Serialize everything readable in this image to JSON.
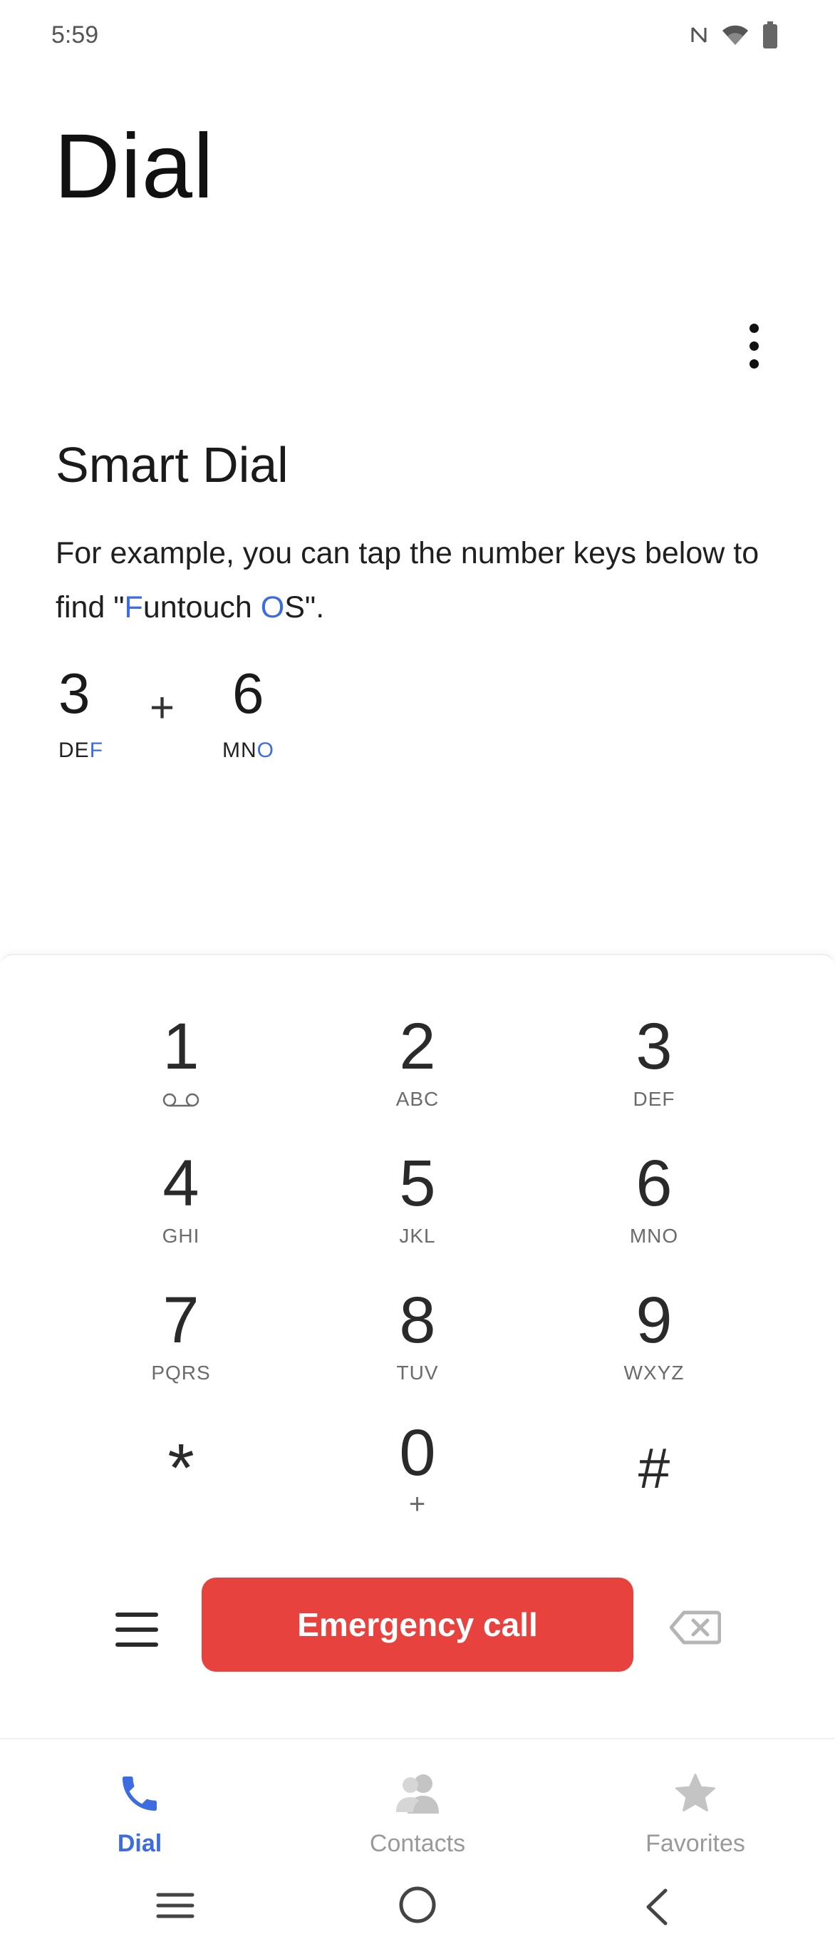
{
  "status_bar": {
    "time": "5:59",
    "icons": [
      "nfc-icon",
      "wifi-icon",
      "battery-icon"
    ]
  },
  "header": {
    "title": "Dial",
    "more_icon": "more-vert-icon"
  },
  "smart_dial": {
    "title": "Smart Dial",
    "desc_part1": "For example, you can tap the number keys below to find \"",
    "desc_hl1": "F",
    "desc_part2": "untouch ",
    "desc_hl2": "O",
    "desc_part3": "S\".",
    "example": {
      "key1_digit": "3",
      "key1_letters_plain": "DE",
      "key1_letters_hl": "F",
      "plus": "+",
      "key2_digit": "6",
      "key2_letters_plain": "MN",
      "key2_letters_hl": "O"
    }
  },
  "keypad": {
    "keys": [
      {
        "digit": "1",
        "letters": ""
      },
      {
        "digit": "2",
        "letters": "ABC"
      },
      {
        "digit": "3",
        "letters": "DEF"
      },
      {
        "digit": "4",
        "letters": "GHI"
      },
      {
        "digit": "5",
        "letters": "JKL"
      },
      {
        "digit": "6",
        "letters": "MNO"
      },
      {
        "digit": "7",
        "letters": "PQRS"
      },
      {
        "digit": "8",
        "letters": "TUV"
      },
      {
        "digit": "9",
        "letters": "WXYZ"
      },
      {
        "digit": "*",
        "letters": ""
      },
      {
        "digit": "0",
        "letters": "+"
      },
      {
        "digit": "#",
        "letters": ""
      }
    ]
  },
  "actions": {
    "menu_icon": "menu-icon",
    "emergency_label": "Emergency call",
    "backspace_icon": "backspace-icon"
  },
  "bottom_nav": {
    "items": [
      {
        "label": "Dial",
        "icon": "phone-icon",
        "active": true
      },
      {
        "label": "Contacts",
        "icon": "contacts-icon",
        "active": false
      },
      {
        "label": "Favorites",
        "icon": "star-icon",
        "active": false
      }
    ]
  },
  "system_nav": [
    "recents-icon",
    "home-icon",
    "back-icon"
  ],
  "colors": {
    "accent": "#3d6be0",
    "emergency": "#e8423e",
    "inactive": "#9a9a9a"
  }
}
